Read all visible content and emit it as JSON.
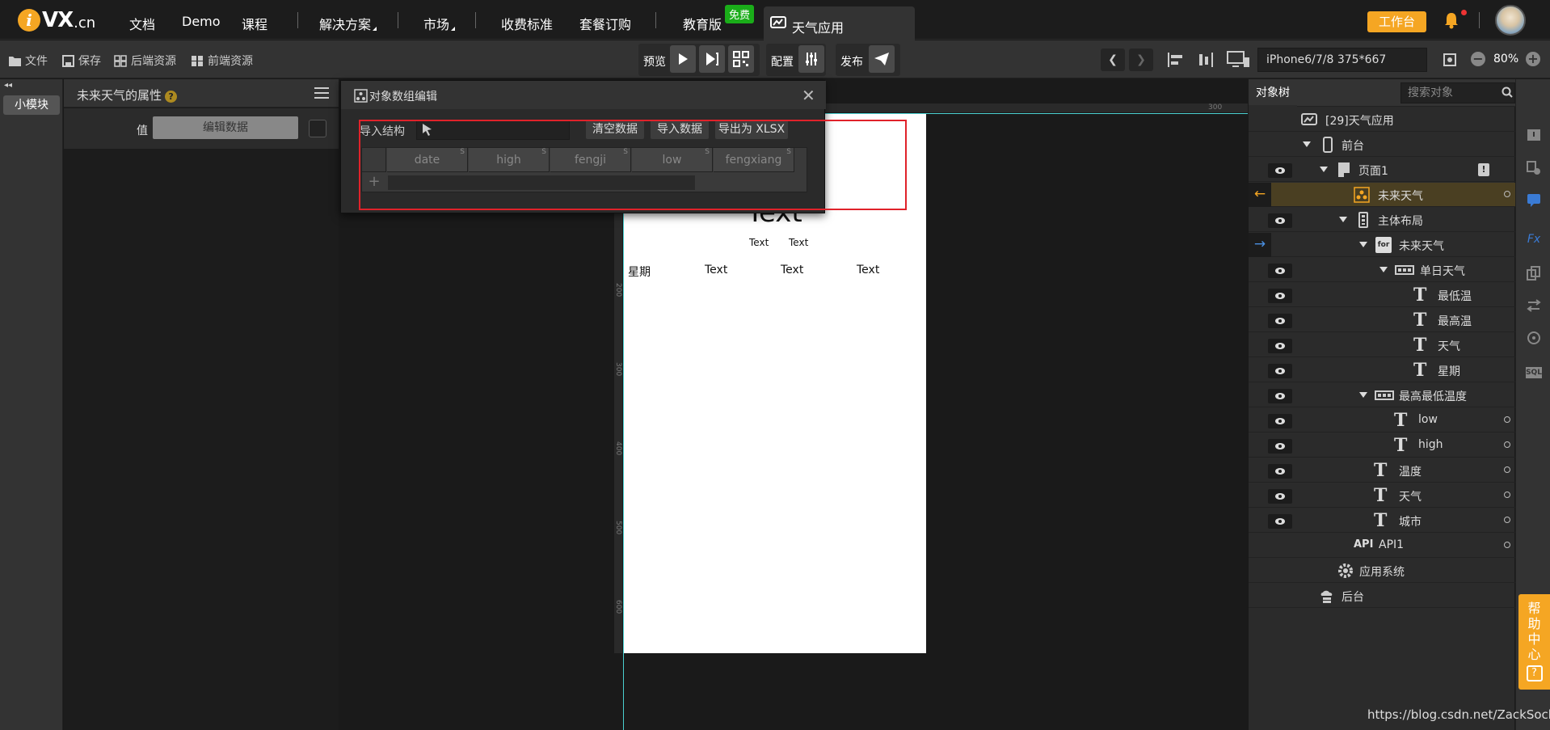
{
  "logo": {
    "mark": "i",
    "text": "VX",
    "suffix": ".cn"
  },
  "nav": [
    {
      "label": "文档"
    },
    {
      "label": "Demo"
    },
    {
      "label": "课程"
    },
    {
      "label": "解决方案"
    },
    {
      "label": "市场"
    },
    {
      "label": "收费标准"
    },
    {
      "label": "套餐订购"
    },
    {
      "label": "教育版"
    }
  ],
  "nav_badge": "免费",
  "app_tab": {
    "label": "天气应用"
  },
  "workbench": "工作台",
  "toolbar": {
    "file": "文件",
    "save": "保存",
    "backend_res": "后端资源",
    "frontend_res": "前端资源",
    "preview": "预览",
    "config": "配置",
    "publish": "发布",
    "device": "iPhone6/7/8 375*667",
    "zoom": "80%"
  },
  "left_rail": {
    "tab": "小模块"
  },
  "props": {
    "title": "未来天气的属性",
    "value_label": "值",
    "edit_button": "编辑数据"
  },
  "dialog": {
    "title": "对象数组编辑",
    "import_structure": "导入结构",
    "clear": "清空数据",
    "import": "导入数据",
    "export": "导出为 XLSX",
    "columns": [
      "date",
      "high",
      "fengji",
      "low",
      "fengxiang"
    ],
    "column_tag": "S",
    "add": "+"
  },
  "phone": {
    "big_text": "Text",
    "sub1": "Text",
    "sub2": "Text",
    "row_label": "星期",
    "row_cells": [
      "Text",
      "Text",
      "Text"
    ]
  },
  "ruler": {
    "h": [
      "300"
    ],
    "v": [
      "200",
      "300",
      "400",
      "500",
      "600"
    ]
  },
  "right_panel": {
    "tab": "对象树",
    "search_placeholder": "搜索对象",
    "tree": [
      {
        "label": "[29]天气应用"
      },
      {
        "label": "前台"
      },
      {
        "label": "页面1"
      },
      {
        "label": "未来天气"
      },
      {
        "label": "主体布局"
      },
      {
        "label": "未来天气",
        "badge": "for"
      },
      {
        "label": "单日天气"
      },
      {
        "label": "最低温"
      },
      {
        "label": "最高温"
      },
      {
        "label": "天气"
      },
      {
        "label": "星期"
      },
      {
        "label": "最高最低温度"
      },
      {
        "label": "low"
      },
      {
        "label": "high"
      },
      {
        "label": "温度"
      },
      {
        "label": "天气"
      },
      {
        "label": "城市"
      },
      {
        "label": "API1",
        "badge": "API"
      },
      {
        "label": "应用系统"
      },
      {
        "label": "后台"
      }
    ]
  },
  "far_rail": {
    "fx": "Fx",
    "sql": "SQL"
  },
  "help_center": {
    "label": "帮助中心",
    "q": "?"
  },
  "watermark": "https://blog.csdn.net/ZackSock",
  "colors": {
    "accent": "#f5a623",
    "highlight": "#e0222a",
    "guide": "#4ad0d0",
    "badge": "#1aad19"
  }
}
